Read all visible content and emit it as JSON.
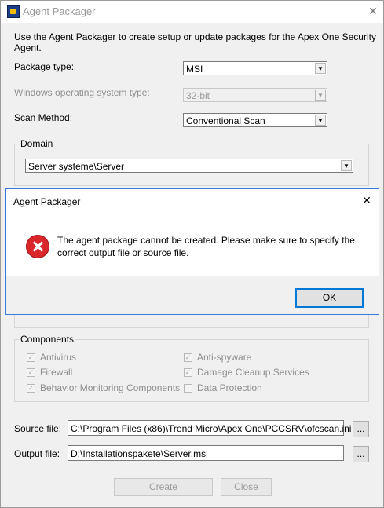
{
  "window": {
    "title": "Agent Packager",
    "close_glyph": "✕"
  },
  "intro": "Use the Agent Packager to create setup or update packages for the Apex One Security Agent.",
  "package_type": {
    "label": "Package type:",
    "value": "MSI"
  },
  "os_type": {
    "label": "Windows operating system type:",
    "value": "32-bit"
  },
  "scan_method": {
    "label": "Scan Method:",
    "value": "Conventional Scan"
  },
  "domain": {
    "label": "Domain",
    "value": "Server systeme\\Server"
  },
  "components": {
    "label": "Components",
    "items": [
      {
        "label": "Antivirus",
        "checked": true
      },
      {
        "label": "Anti-spyware",
        "checked": true
      },
      {
        "label": "Firewall",
        "checked": true
      },
      {
        "label": "Damage Cleanup Services",
        "checked": true
      },
      {
        "label": "Behavior Monitoring Components",
        "checked": true
      },
      {
        "label": "Data Protection",
        "checked": false
      }
    ]
  },
  "source_file": {
    "label": "Source file:",
    "value": "C:\\Program Files (x86)\\Trend Micro\\Apex One\\PCCSRV\\ofcscan.ini",
    "browse": "..."
  },
  "output_file": {
    "label": "Output file:",
    "value": "D:\\Installationspakete\\Server.msi",
    "browse": "..."
  },
  "buttons": {
    "create": "Create",
    "close": "Close"
  },
  "dialog": {
    "title": "Agent Packager",
    "close_glyph": "✕",
    "message_line1": "The agent package cannot be created. Please make sure to specify the",
    "message_line2": "correct output file or source file.",
    "ok": "OK"
  },
  "icons": {
    "app": "agent-packager-icon",
    "error": "error-icon",
    "dropdown": "chevron-down-icon"
  }
}
